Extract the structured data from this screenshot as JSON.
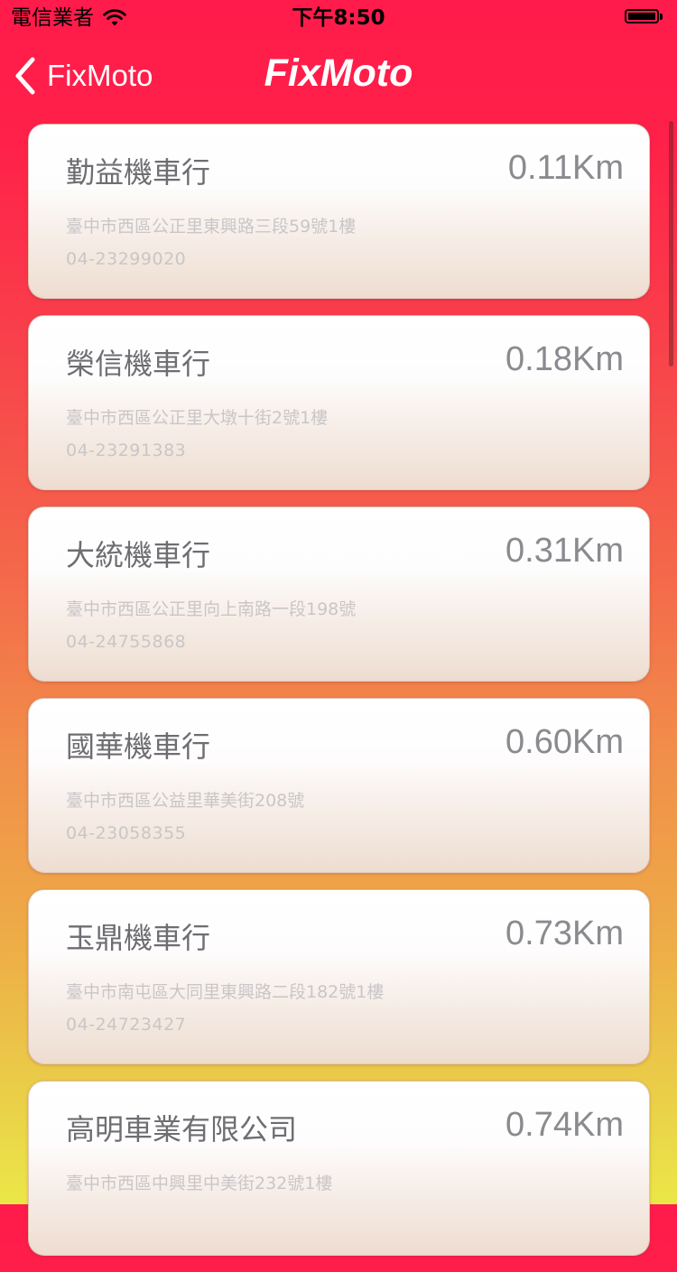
{
  "status_bar": {
    "carrier": "電信業者",
    "time": "下午8:50",
    "icons": [
      "wifi-icon",
      "battery-icon"
    ]
  },
  "nav": {
    "back_label": "FixMoto",
    "back_icon": "chevron-left-icon",
    "title": "FixMoto"
  },
  "colors": {
    "gradient_top": "#ff1b4b",
    "gradient_bottom": "#ebe748",
    "text_primary": "#6d6d72",
    "text_secondary": "#c9c6c8"
  },
  "shops": [
    {
      "name": "勤益機車行",
      "distance": "0.11Km",
      "address": "臺中市西區公正里東興路三段59號1樓",
      "phone": "04-23299020"
    },
    {
      "name": "榮信機車行",
      "distance": "0.18Km",
      "address": "臺中市西區公正里大墩十街2號1樓",
      "phone": "04-23291383"
    },
    {
      "name": "大統機車行",
      "distance": "0.31Km",
      "address": "臺中市西區公正里向上南路一段198號",
      "phone": "04-24755868"
    },
    {
      "name": "國華機車行",
      "distance": "0.60Km",
      "address": "臺中市西區公益里華美街208號",
      "phone": "04-23058355"
    },
    {
      "name": "玉鼎機車行",
      "distance": "0.73Km",
      "address": "臺中市南屯區大同里東興路二段182號1樓",
      "phone": "04-24723427"
    },
    {
      "name": "高明車業有限公司",
      "distance": "0.74Km",
      "address": "臺中市西區中興里中美街232號1樓",
      "phone": ""
    }
  ]
}
